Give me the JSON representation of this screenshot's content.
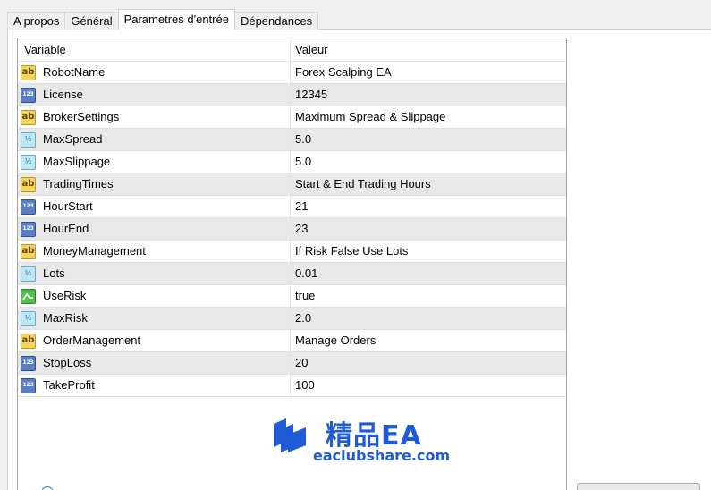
{
  "tabs": [
    {
      "label": "A propos",
      "active": false
    },
    {
      "label": "Général",
      "active": false
    },
    {
      "label": "Parametres d'entrée",
      "active": true
    },
    {
      "label": "Dépendances",
      "active": false
    }
  ],
  "table": {
    "headers": {
      "variable": "Variable",
      "value": "Valeur"
    },
    "rows": [
      {
        "icon": "string-type-icon",
        "name": "RobotName",
        "value": "Forex Scalping EA"
      },
      {
        "icon": "integer-type-icon",
        "name": "License",
        "value": "12345"
      },
      {
        "icon": "string-type-icon",
        "name": "BrokerSettings",
        "value": "Maximum Spread & Slippage"
      },
      {
        "icon": "double-type-icon",
        "name": "MaxSpread",
        "value": "5.0"
      },
      {
        "icon": "double-type-icon",
        "name": "MaxSlippage",
        "value": "5.0"
      },
      {
        "icon": "string-type-icon",
        "name": "TradingTimes",
        "value": "Start & End Trading Hours"
      },
      {
        "icon": "integer-type-icon",
        "name": "HourStart",
        "value": "21"
      },
      {
        "icon": "integer-type-icon",
        "name": "HourEnd",
        "value": "23"
      },
      {
        "icon": "string-type-icon",
        "name": "MoneyManagement",
        "value": "If Risk False Use Lots"
      },
      {
        "icon": "double-type-icon",
        "name": "Lots",
        "value": "0.01"
      },
      {
        "icon": "bool-type-icon",
        "name": "UseRisk",
        "value": "true"
      },
      {
        "icon": "double-type-icon",
        "name": "MaxRisk",
        "value": "2.0"
      },
      {
        "icon": "string-type-icon",
        "name": "OrderManagement",
        "value": "Manage Orders"
      },
      {
        "icon": "integer-type-icon",
        "name": "StopLoss",
        "value": "20"
      },
      {
        "icon": "integer-type-icon",
        "name": "TakeProfit",
        "value": "100"
      }
    ]
  },
  "icon_glyphs": {
    "string": "ab",
    "integer": "123",
    "double": "½"
  },
  "watermark": {
    "title": "精品EA",
    "url": "eaclubshare.com"
  },
  "colors": {
    "accent": "#1f5bd8",
    "alt_row": "#e8e8e8"
  }
}
